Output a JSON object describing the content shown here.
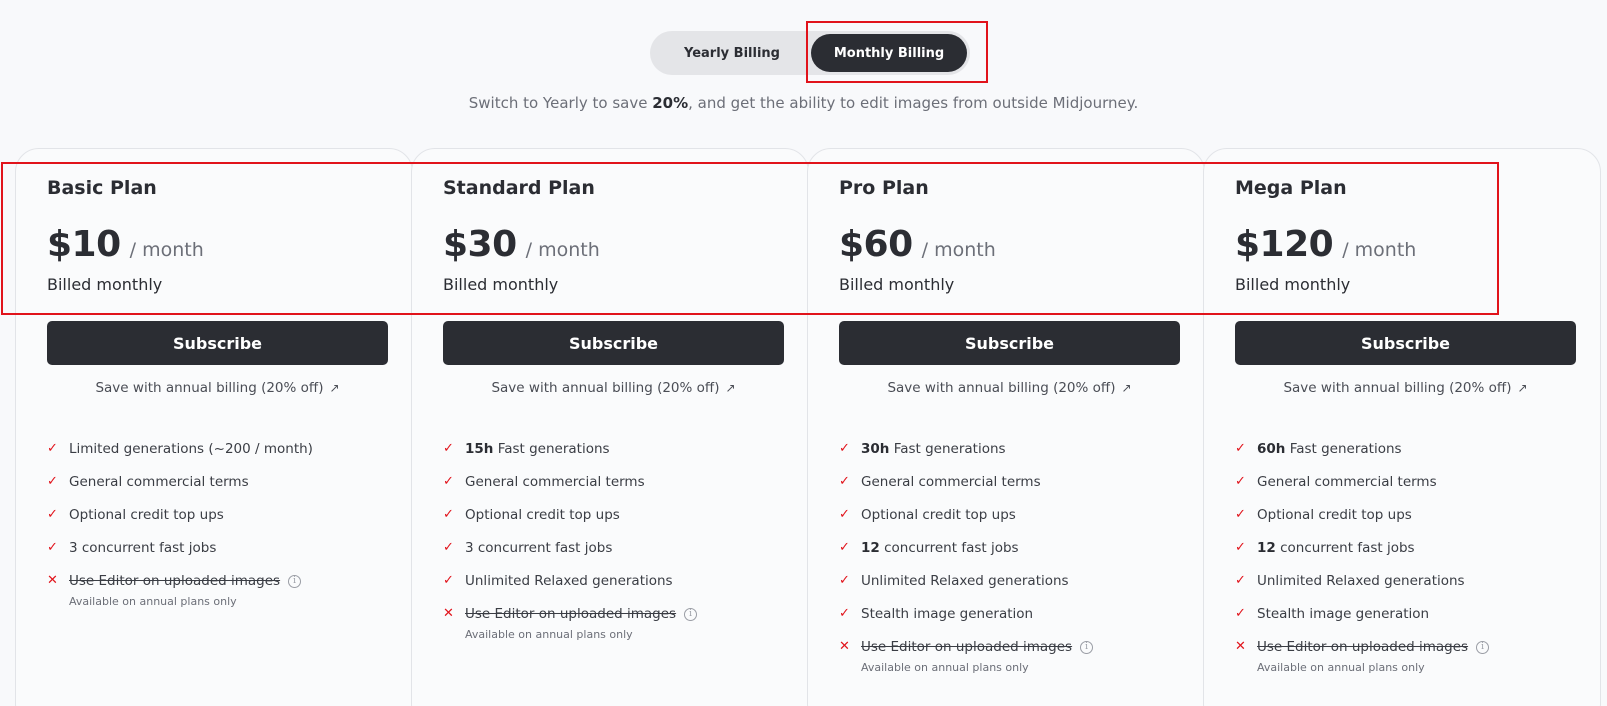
{
  "billing_toggle": {
    "yearly_label": "Yearly Billing",
    "monthly_label": "Monthly Billing",
    "selected": "monthly"
  },
  "subtitle": {
    "prefix": "Switch to Yearly to save ",
    "highlight": "20%",
    "suffix": ", and get the ability to edit images from outside Midjourney."
  },
  "plans": [
    {
      "title": "Basic Plan",
      "price": "$10",
      "per": "/ month",
      "billed": "Billed monthly",
      "subscribe_label": "Subscribe",
      "annual_link": "Save with annual billing (20% off)",
      "features": [
        {
          "bold": "",
          "text": "Limited generations (~200 / month)",
          "included": true
        },
        {
          "bold": "",
          "text": "General commercial terms",
          "included": true
        },
        {
          "bold": "",
          "text": "Optional credit top ups",
          "included": true
        },
        {
          "bold": "",
          "text": "3 concurrent fast jobs",
          "included": true
        },
        {
          "bold": "",
          "text": "Use Editor on uploaded images",
          "included": false,
          "note": "Available on annual plans only"
        }
      ]
    },
    {
      "title": "Standard Plan",
      "price": "$30",
      "per": "/ month",
      "billed": "Billed monthly",
      "subscribe_label": "Subscribe",
      "annual_link": "Save with annual billing (20% off)",
      "features": [
        {
          "bold": "15h",
          "text": " Fast generations",
          "included": true
        },
        {
          "bold": "",
          "text": "General commercial terms",
          "included": true
        },
        {
          "bold": "",
          "text": "Optional credit top ups",
          "included": true
        },
        {
          "bold": "",
          "text": "3 concurrent fast jobs",
          "included": true
        },
        {
          "bold": "",
          "text": "Unlimited Relaxed generations",
          "included": true
        },
        {
          "bold": "",
          "text": "Use Editor on uploaded images",
          "included": false,
          "note": "Available on annual plans only"
        }
      ]
    },
    {
      "title": "Pro Plan",
      "price": "$60",
      "per": "/ month",
      "billed": "Billed monthly",
      "subscribe_label": "Subscribe",
      "annual_link": "Save with annual billing (20% off)",
      "features": [
        {
          "bold": "30h",
          "text": " Fast generations",
          "included": true
        },
        {
          "bold": "",
          "text": "General commercial terms",
          "included": true
        },
        {
          "bold": "",
          "text": "Optional credit top ups",
          "included": true
        },
        {
          "bold": "12",
          "text": " concurrent fast jobs",
          "included": true
        },
        {
          "bold": "",
          "text": "Unlimited Relaxed generations",
          "included": true
        },
        {
          "bold": "",
          "text": "Stealth image generation",
          "included": true
        },
        {
          "bold": "",
          "text": "Use Editor on uploaded images",
          "included": false,
          "note": "Available on annual plans only"
        }
      ]
    },
    {
      "title": "Mega Plan",
      "price": "$120",
      "per": "/ month",
      "billed": "Billed monthly",
      "subscribe_label": "Subscribe",
      "annual_link": "Save with annual billing (20% off)",
      "features": [
        {
          "bold": "60h",
          "text": " Fast generations",
          "included": true
        },
        {
          "bold": "",
          "text": "General commercial terms",
          "included": true
        },
        {
          "bold": "",
          "text": "Optional credit top ups",
          "included": true
        },
        {
          "bold": "12",
          "text": " concurrent fast jobs",
          "included": true
        },
        {
          "bold": "",
          "text": "Unlimited Relaxed generations",
          "included": true
        },
        {
          "bold": "",
          "text": "Stealth image generation",
          "included": true
        },
        {
          "bold": "",
          "text": "Use Editor on uploaded images",
          "included": false,
          "note": "Available on annual plans only"
        }
      ]
    }
  ],
  "colors": {
    "accent_red": "#e1131b",
    "dark": "#2b2d33",
    "background": "#f8f9fb"
  },
  "icons": {
    "check": "check-icon",
    "cross": "cross-icon",
    "info": "info-icon",
    "external": "arrow-up-right-icon"
  }
}
